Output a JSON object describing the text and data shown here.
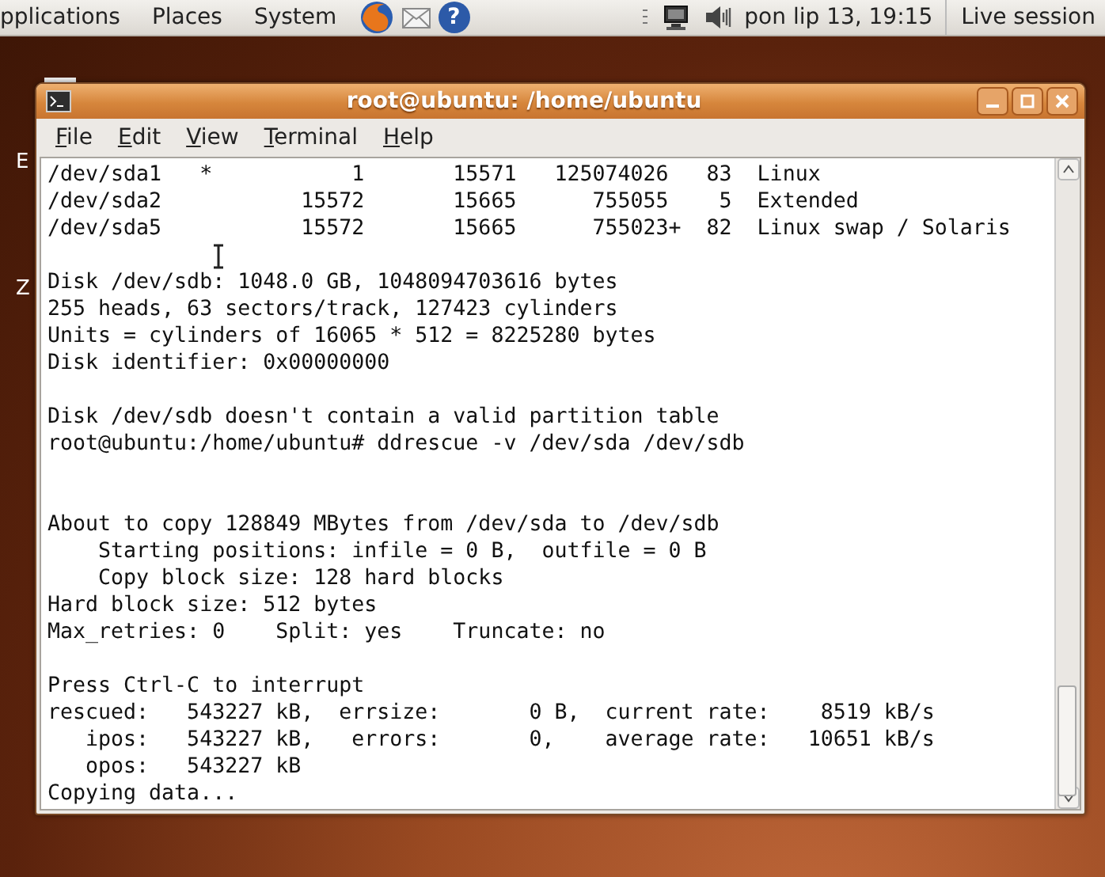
{
  "top_panel": {
    "menus": [
      "pplications",
      "Places",
      "System"
    ],
    "help_glyph": "?",
    "clock": "pon lip 13, 19:15",
    "session": "Live session"
  },
  "desktop_labels": [
    "E",
    "Z"
  ],
  "window": {
    "title": "root@ubuntu: /home/ubuntu"
  },
  "menu_bar": [
    {
      "mnemonic": "F",
      "rest": "ile"
    },
    {
      "mnemonic": "E",
      "rest": "dit"
    },
    {
      "mnemonic": "V",
      "rest": "iew"
    },
    {
      "mnemonic": "T",
      "rest": "erminal"
    },
    {
      "mnemonic": "H",
      "rest": "elp"
    }
  ],
  "terminal_lines": [
    {
      "kind": "text",
      "text": "/dev/sda1   *           1       15571   125074026   83  Linux"
    },
    {
      "kind": "text",
      "text": "/dev/sda2           15572       15665      755055    5  Extended"
    },
    {
      "kind": "text",
      "text": "/dev/sda5           15572       15665      755023+  82  Linux swap / Solaris"
    },
    {
      "kind": "blank"
    },
    {
      "kind": "text",
      "text": "Disk /dev/sdb: 1048.0 GB, 1048094703616 bytes"
    },
    {
      "kind": "text",
      "text": "255 heads, 63 sectors/track, 127423 cylinders"
    },
    {
      "kind": "text",
      "text": "Units = cylinders of 16065 * 512 = 8225280 bytes"
    },
    {
      "kind": "text",
      "text": "Disk identifier: 0x00000000"
    },
    {
      "kind": "blank"
    },
    {
      "kind": "text",
      "text": "Disk /dev/sdb doesn't contain a valid partition table"
    },
    {
      "kind": "text",
      "text": "root@ubuntu:/home/ubuntu# ddrescue -v /dev/sda /dev/sdb"
    },
    {
      "kind": "blank"
    },
    {
      "kind": "blank"
    },
    {
      "kind": "text",
      "text": "About to copy 128849 MBytes from /dev/sda to /dev/sdb"
    },
    {
      "kind": "text",
      "text": "    Starting positions: infile = 0 B,  outfile = 0 B"
    },
    {
      "kind": "text",
      "text": "    Copy block size: 128 hard blocks"
    },
    {
      "kind": "text",
      "text": "Hard block size: 512 bytes"
    },
    {
      "kind": "text",
      "text": "Max_retries: 0    Split: yes    Truncate: no"
    },
    {
      "kind": "blank"
    },
    {
      "kind": "text",
      "text": "Press Ctrl-C to interrupt"
    },
    {
      "kind": "text",
      "text": "rescued:   543227 kB,  errsize:       0 B,  current rate:    8519 kB/s"
    },
    {
      "kind": "text",
      "text": "   ipos:   543227 kB,   errors:       0,    average rate:   10651 kB/s"
    },
    {
      "kind": "text",
      "text": "   opos:   543227 kB"
    },
    {
      "kind": "text",
      "text": "Copying data..."
    }
  ]
}
